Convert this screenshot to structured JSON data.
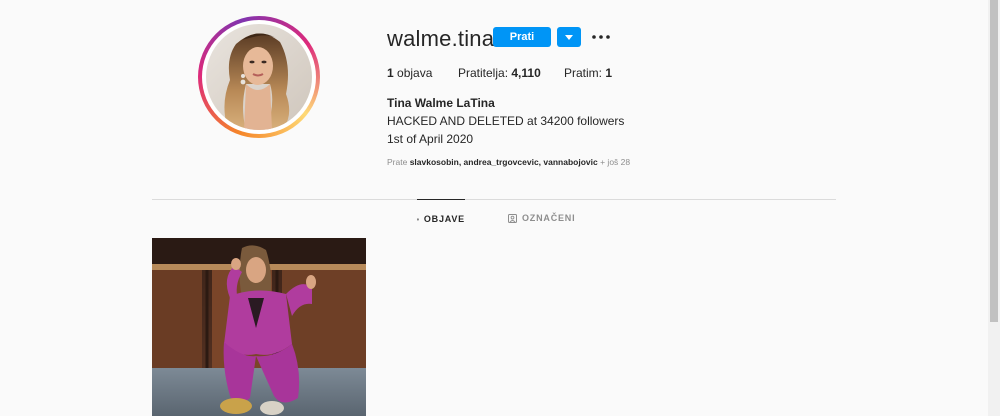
{
  "profile": {
    "username": "walme.tina",
    "follow_label": "Prati",
    "full_name": "Tina Walme LaTina",
    "bio_lines": [
      "HACKED AND DELETED at 34200 followers",
      "1st of April 2020"
    ]
  },
  "stats": {
    "posts_count": "1",
    "posts_label": "objava",
    "followers_label": "Pratitelja:",
    "followers_count": "4,110",
    "following_label": "Pratim:",
    "following_count": "1"
  },
  "followed_by": {
    "prefix": "Prate",
    "names": "slavkosobin, andrea_trgovcevic, vannabojovic",
    "more": "+ još 28"
  },
  "tabs": [
    {
      "label": "OBJAVE",
      "icon": "grid-icon",
      "active": true
    },
    {
      "label": "OZNAČENI",
      "icon": "tagged-icon",
      "active": false
    }
  ],
  "colors": {
    "accent": "#0095f6",
    "background": "#fafafa",
    "divider": "#dbdbdb",
    "muted": "#8e8e8e"
  },
  "icons": [
    "chevron-down-icon",
    "more-options-icon",
    "grid-icon",
    "tagged-icon"
  ]
}
